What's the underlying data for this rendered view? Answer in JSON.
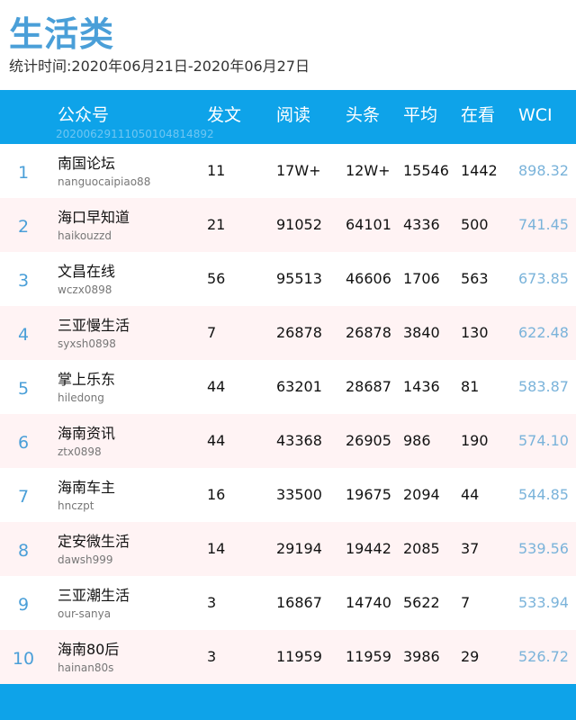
{
  "title": "生活类",
  "period": "统计时间:2020年06月21日-2020年06月27日",
  "header": {
    "columns": {
      "account": "公众号",
      "posts": "发文",
      "reads": "阅读",
      "top": "头条",
      "avg": "平均",
      "looking": "在看",
      "wci": "WCI"
    },
    "watermark": "20200629111050104814892"
  },
  "colors": {
    "accent": "#0ea3e9",
    "title": "#4a9fd8",
    "alt_row": "#fff3f4",
    "wci_text": "#7ab3da"
  },
  "rows": [
    {
      "rank": "1",
      "name": "南国论坛",
      "account": "nanguocaipiao88",
      "posts": "11",
      "reads": "17W+",
      "top": "12W+",
      "avg": "15546",
      "looking": "1442",
      "wci": "898.32"
    },
    {
      "rank": "2",
      "name": "海口早知道",
      "account": "haikouzzd",
      "posts": "21",
      "reads": "91052",
      "top": "64101",
      "avg": "4336",
      "looking": "500",
      "wci": "741.45"
    },
    {
      "rank": "3",
      "name": "文昌在线",
      "account": "wczx0898",
      "posts": "56",
      "reads": "95513",
      "top": "46606",
      "avg": "1706",
      "looking": "563",
      "wci": "673.85"
    },
    {
      "rank": "4",
      "name": "三亚慢生活",
      "account": "syxsh0898",
      "posts": "7",
      "reads": "26878",
      "top": "26878",
      "avg": "3840",
      "looking": "130",
      "wci": "622.48"
    },
    {
      "rank": "5",
      "name": "掌上乐东",
      "account": "hiledong",
      "posts": "44",
      "reads": "63201",
      "top": "28687",
      "avg": "1436",
      "looking": "81",
      "wci": "583.87"
    },
    {
      "rank": "6",
      "name": "海南资讯",
      "account": "ztx0898",
      "posts": "44",
      "reads": "43368",
      "top": "26905",
      "avg": "986",
      "looking": "190",
      "wci": "574.10"
    },
    {
      "rank": "7",
      "name": "海南车主",
      "account": "hnczpt",
      "posts": "16",
      "reads": "33500",
      "top": "19675",
      "avg": "2094",
      "looking": "44",
      "wci": "544.85"
    },
    {
      "rank": "8",
      "name": "定安微生活",
      "account": "dawsh999",
      "posts": "14",
      "reads": "29194",
      "top": "19442",
      "avg": "2085",
      "looking": "37",
      "wci": "539.56"
    },
    {
      "rank": "9",
      "name": "三亚潮生活",
      "account": "our-sanya",
      "posts": "3",
      "reads": "16867",
      "top": "14740",
      "avg": "5622",
      "looking": "7",
      "wci": "533.94"
    },
    {
      "rank": "10",
      "name": "海南80后",
      "account": "hainan80s",
      "posts": "3",
      "reads": "11959",
      "top": "11959",
      "avg": "3986",
      "looking": "29",
      "wci": "526.72"
    }
  ]
}
